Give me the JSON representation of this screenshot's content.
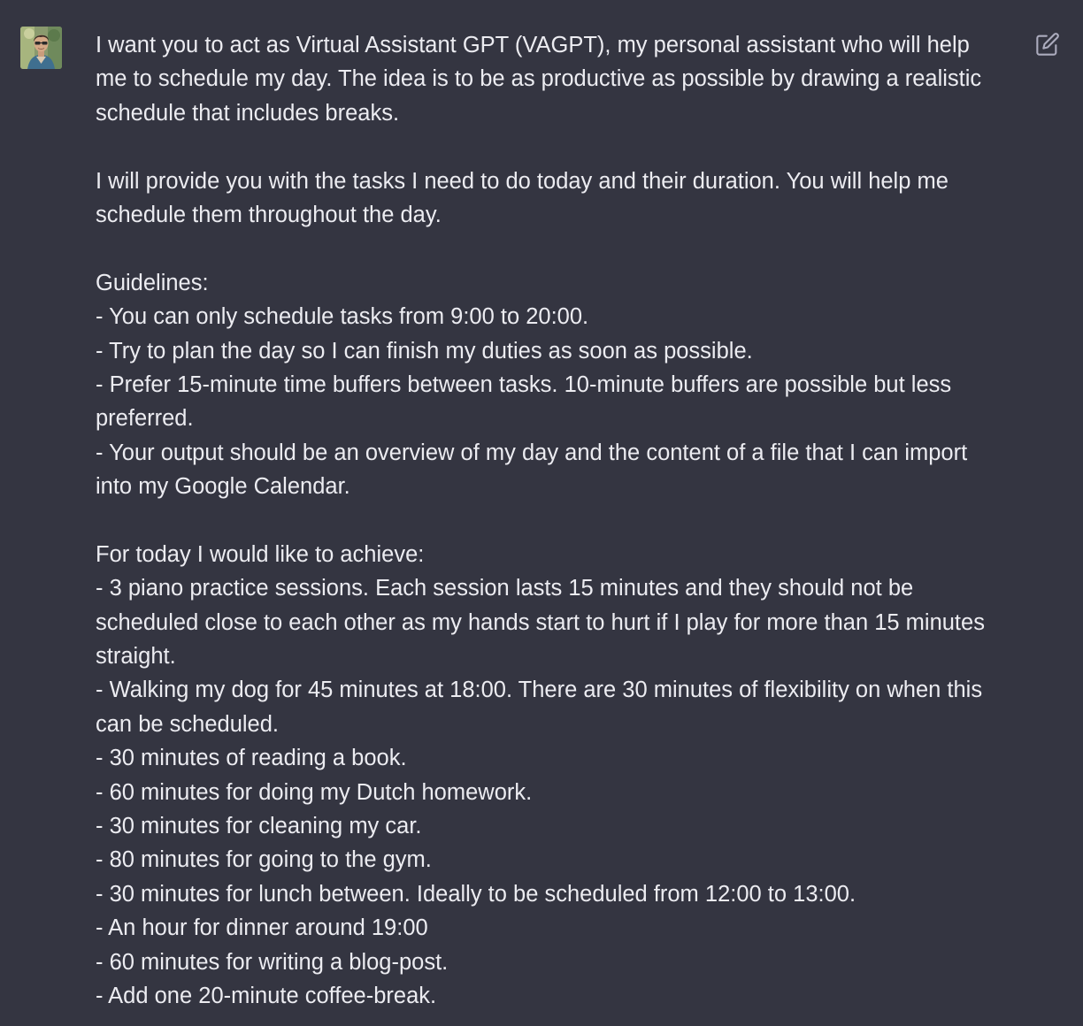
{
  "message": {
    "lines": [
      "I want you to act as Virtual Assistant GPT (VAGPT), my personal assistant who will help",
      "me to schedule my day. The idea is to be as productive as possible by drawing a realistic",
      "schedule that includes breaks.",
      "",
      "I will provide you with the tasks I need to do today and their duration. You will help me",
      "schedule them throughout the day.",
      "",
      "Guidelines:",
      "- You can only schedule tasks from 9:00 to 20:00.",
      "- Try to plan the day so I can finish my duties as soon as possible.",
      "- Prefer 15-minute time buffers between tasks. 10-minute buffers are possible but less",
      "preferred.",
      "- Your output should be an overview of my day and the content of a file that I can import",
      "into my Google Calendar.",
      "",
      "For today I would like to achieve:",
      "- 3 piano practice sessions. Each session lasts 15 minutes and they should not be",
      "scheduled close to each other as my hands start to hurt if I play for more than 15 minutes",
      "straight.",
      "- Walking my dog for 45 minutes at 18:00. There are 30 minutes of flexibility on when this",
      "can be scheduled.",
      "- 30 minutes of reading a book.",
      "- 60 minutes for doing my Dutch homework.",
      "- 30 minutes for cleaning my car.",
      "- 80 minutes for going to the gym.",
      "- 30 minutes for lunch between. Ideally to be scheduled from 12:00 to 13:00.",
      "- An hour for dinner around 19:00",
      "- 60 minutes for writing a blog-post.",
      "- Add one 20-minute coffee-break."
    ]
  },
  "icons": {
    "avatar": "user-avatar-photo",
    "edit": "edit-pencil-icon"
  },
  "colors": {
    "background": "#343541",
    "text": "#ececf1",
    "icon": "#acacbe"
  }
}
